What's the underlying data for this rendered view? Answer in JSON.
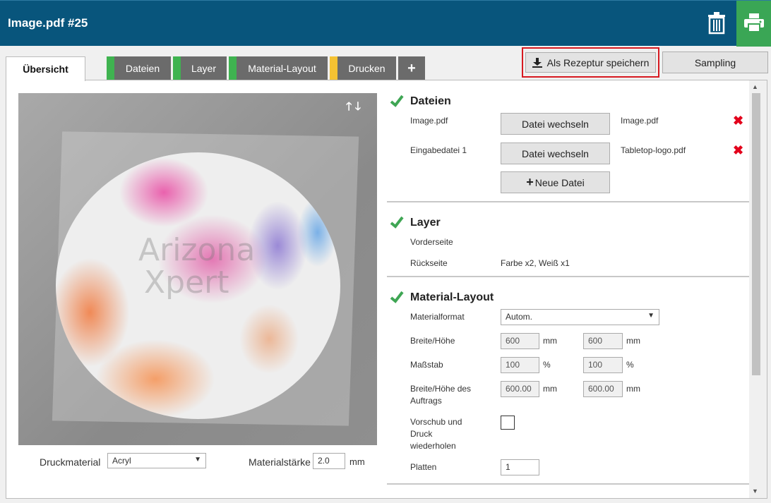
{
  "header": {
    "title": "Image.pdf #25",
    "trash_icon": "trash-icon",
    "print_icon": "printer-icon",
    "print_color": "#3aa655",
    "bar_color": "#08557c"
  },
  "tabs": [
    {
      "label": "Übersicht",
      "active": true
    },
    {
      "label": "Dateien",
      "stripe": "#3fb350"
    },
    {
      "label": "Layer",
      "stripe": "#3fb350"
    },
    {
      "label": "Material-Layout",
      "stripe": "#3fb350"
    },
    {
      "label": "Drucken",
      "stripe": "#f5c232"
    },
    {
      "label": "+"
    }
  ],
  "toolbar": {
    "save_recipe": "Als Rezeptur speichern",
    "sampling": "Sampling"
  },
  "preview": {
    "watermark_line1": "Arizona",
    "watermark_line2": "Xpert",
    "arrows": "🡑 🡓"
  },
  "below": {
    "media_label": "Druckmaterial",
    "media_value": "Acryl",
    "thickness_label": "Materialstärke",
    "thickness_value": "2.0",
    "thickness_unit": "mm"
  },
  "dateien": {
    "title": "Dateien",
    "row1_label": "Image.pdf",
    "row1_button": "Datei wechseln",
    "row1_file": "Image.pdf",
    "row2_label": "Eingabedatei 1",
    "row2_button": "Datei wechseln",
    "row2_file": "Tabletop-logo.pdf",
    "new_file": "Neue Datei"
  },
  "layer": {
    "title": "Layer",
    "front_label": "Vorderseite",
    "front_value": "",
    "back_label": "Rückseite",
    "back_value": "Farbe x2, Weiß x1"
  },
  "material": {
    "title": "Material-Layout",
    "format_label": "Materialformat",
    "format_value": "Autom.",
    "size_label": "Breite/Höhe",
    "width": "600",
    "height": "600",
    "unit_mm": "mm",
    "scale_label": "Maßstab",
    "scale_w": "100",
    "scale_h": "100",
    "unit_pct": "%",
    "job_size_label_1": "Breite/Höhe des",
    "job_size_label_2": "Auftrags",
    "job_w": "600.00",
    "job_h": "600.00",
    "repeat_label_1": "Vorschub und",
    "repeat_label_2": "Druck",
    "repeat_label_3": "wiederholen",
    "repeat_checked": false,
    "plates_label": "Platten",
    "plates_value": "1"
  }
}
